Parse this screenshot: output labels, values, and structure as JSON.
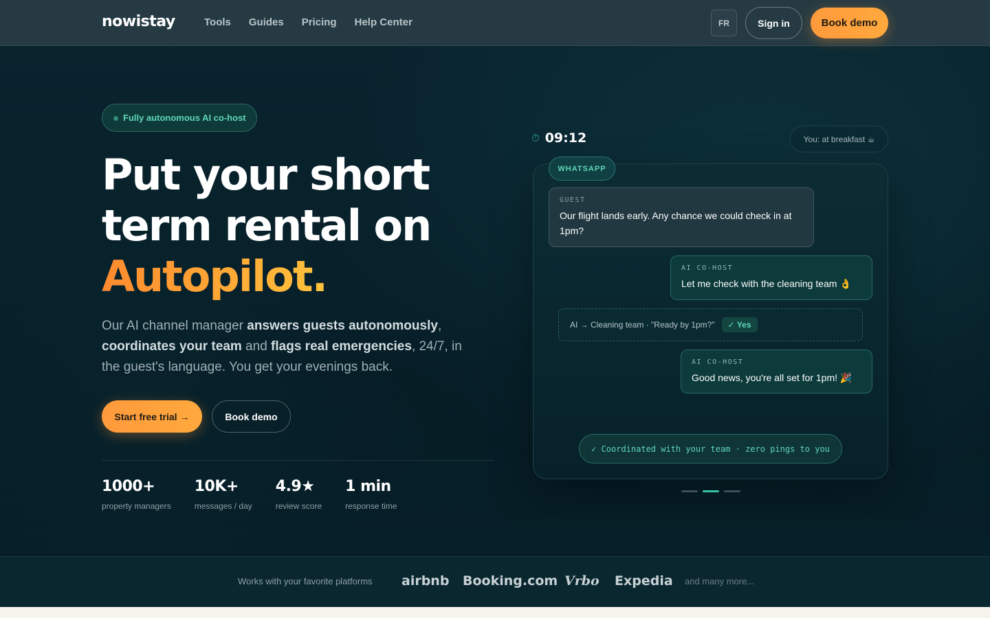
{
  "header": {
    "logo": "nowistay",
    "nav": [
      "Tools",
      "Guides",
      "Pricing",
      "Help Center"
    ],
    "lang": "FR",
    "signin_label": "Sign in",
    "demo_label": "Book demo"
  },
  "hero": {
    "badge": "Fully autonomous AI co-host",
    "title_line1": "Put your short",
    "title_line2": "term rental on",
    "title_accent": "Autopilot.",
    "subtitle": {
      "p1": "Our AI channel manager ",
      "b1": "answers guests autonomously",
      "p2": ", ",
      "b2": "coordinates your team",
      "p3": " and ",
      "b3": "flags real emergencies",
      "p4": ", 24/7, in the guest's language. You get your evenings back."
    },
    "trial_label": "Start free trial →",
    "demo_label": "Book demo",
    "stats": [
      {
        "value": "1000+",
        "label": "property managers"
      },
      {
        "value": "10K+",
        "label": "messages / day"
      },
      {
        "value": "4.9★",
        "label": "review score"
      },
      {
        "value": "1 min",
        "label": "response time"
      }
    ]
  },
  "chat": {
    "clock_icon": "⏱",
    "time": "09:12",
    "status": "You: at breakfast ☕",
    "channel": "WHATSAPP",
    "guest_label": "GUEST",
    "guest_text": "Our flight lands early. Any chance we could check in at 1pm?",
    "ai1_label": "AI CO-HOST",
    "ai1_text": "Let me check with the cleaning team 👌",
    "coord_text": "AI → Cleaning team · \"Ready by 1pm?\"",
    "coord_yes": "✓ Yes",
    "ai2_label": "AI CO-HOST",
    "ai2_text": "Good news, you're all set for 1pm! 🎉",
    "footer_pill": "✓ Coordinated with your team · zero pings to you",
    "pager_active_index": 1,
    "pager_count": 3
  },
  "platforms": {
    "intro": "Works with your favorite platforms",
    "logos": [
      "airbnb",
      "Booking.com",
      "Vrbo",
      "Expedia"
    ],
    "more": "and many more..."
  },
  "colors": {
    "accent_orange": "#ff9a3c",
    "accent_teal": "#5fd6b8",
    "background": "#06202a"
  }
}
